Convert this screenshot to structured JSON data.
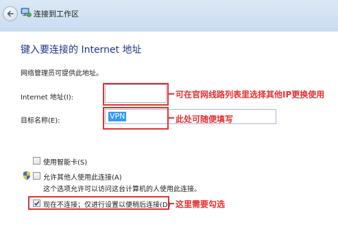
{
  "window": {
    "title": "连接到工作区"
  },
  "main": {
    "heading": "键入要连接的 Internet 地址",
    "description": "网络管理员可提供此地址。",
    "internet_address_label": "Internet 地址(I):",
    "internet_address_value": "",
    "destination_name_label": "目标名称(E):",
    "destination_name_value": "VPN",
    "use_smartcard_label": "使用智能卡(S)",
    "use_smartcard_checked": false,
    "allow_others_label": "允许其他人使用此连接(A)",
    "allow_others_checked": false,
    "allow_others_note": "这个选项允许可以访问这台计算机的人使用此连接。",
    "dont_connect_label": "现在不连接；仅进行设置以便稍后连接(D)",
    "dont_connect_checked": true
  },
  "annotations": {
    "address_note": "可在官网线路列表里选择其他IP更换使用",
    "name_note": "此处可随便填写",
    "checkbox_note": "这里需要勾选",
    "color": "#e53030"
  },
  "colors": {
    "heading": "#1e3287",
    "selection": "#3399ff",
    "titlebar": "#c9dcef"
  }
}
